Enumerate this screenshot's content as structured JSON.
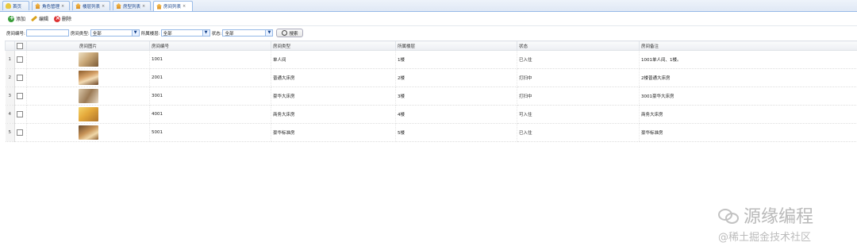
{
  "tabs": [
    {
      "label": "首页",
      "icon": "bulb-icon",
      "closable": false
    },
    {
      "label": "角色管理",
      "icon": "house-icon",
      "closable": true
    },
    {
      "label": "楼层列表",
      "icon": "house-icon",
      "closable": true
    },
    {
      "label": "房型列表",
      "icon": "house-icon",
      "closable": true
    },
    {
      "label": "房间列表",
      "icon": "house-icon",
      "closable": true
    }
  ],
  "close_glyph": "×",
  "toolbar": {
    "add": "添加",
    "edit": "编辑",
    "delete": "删除"
  },
  "search": {
    "room_no_label": "房间编号:",
    "room_no_value": "",
    "room_type_label": "房间类型:",
    "room_type_value": "全部",
    "floor_label": "所属楼层:",
    "floor_value": "全部",
    "status_label": "状态:",
    "status_value": "全部",
    "search_button": "搜索"
  },
  "columns": [
    "房间图片",
    "房间编号",
    "房间类型",
    "所属楼层",
    "状态",
    "房间备注"
  ],
  "rows": [
    {
      "n": "1",
      "img": "t1",
      "no": "1001",
      "type": "单人间",
      "floor": "1楼",
      "status": "已入住",
      "remark": "1001单人间、1楼。"
    },
    {
      "n": "2",
      "img": "t2",
      "no": "2001",
      "type": "普通大床房",
      "floor": "2楼",
      "status": "打扫中",
      "remark": "2楼普通大床房"
    },
    {
      "n": "3",
      "img": "t3",
      "no": "3001",
      "type": "豪华大床房",
      "floor": "3楼",
      "status": "打扫中",
      "remark": "3001豪华大床房"
    },
    {
      "n": "4",
      "img": "t4",
      "no": "4001",
      "type": "商务大床房",
      "floor": "4楼",
      "status": "可入住",
      "remark": "商务大床房"
    },
    {
      "n": "5",
      "img": "t5",
      "no": "5001",
      "type": "豪华标准房",
      "floor": "5楼",
      "status": "已入住",
      "remark": "豪华标准房"
    }
  ],
  "watermark": {
    "brand": "源缘编程",
    "site": "@稀土掘金技术社区"
  }
}
